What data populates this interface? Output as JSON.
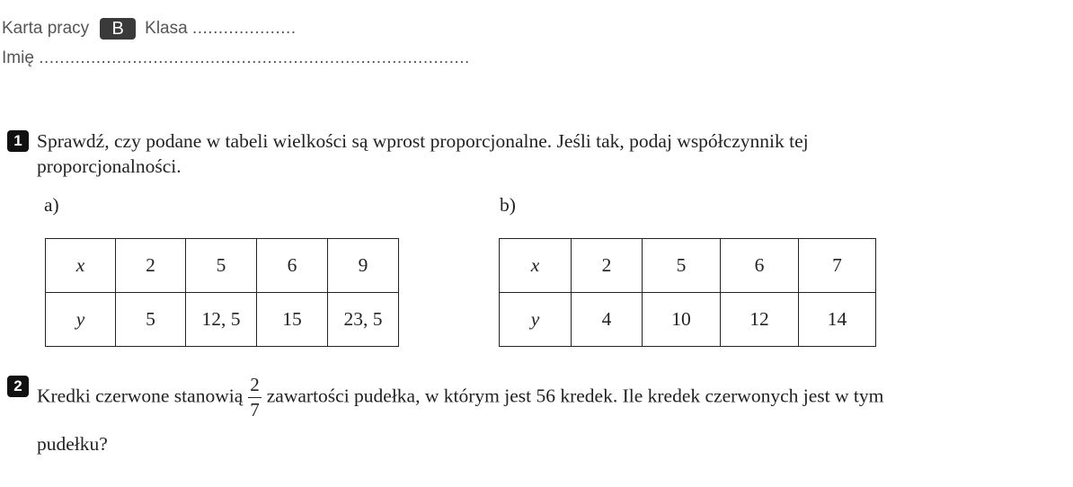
{
  "header": {
    "worksheet_label": "Karta pracy",
    "variant": "B",
    "class_label": "Klasa",
    "class_dots": "....................",
    "name_label": "Imię",
    "name_dots": "..................................................................................."
  },
  "task1": {
    "number": "1",
    "text_line1": "Sprawdź, czy podane w tabeli wielkości są wprost proporcjonalne. Jeśli tak, podaj współczynnik tej",
    "text_line2": "proporcjonalności.",
    "part_a": {
      "label": "a)",
      "x_label": "x",
      "y_label": "y",
      "x_values": [
        "2",
        "5",
        "6",
        "9"
      ],
      "y_values": [
        "5",
        "12, 5",
        "15",
        "23, 5"
      ]
    },
    "part_b": {
      "label": "b)",
      "x_label": "x",
      "y_label": "y",
      "x_values": [
        "2",
        "5",
        "6",
        "7"
      ],
      "y_values": [
        "4",
        "10",
        "12",
        "14"
      ]
    }
  },
  "task2": {
    "number": "2",
    "text_before": "Kredki czerwone stanowią",
    "fraction_numerator": "2",
    "fraction_denominator": "7",
    "text_after": "zawartości pudełka, w którym jest 56 kredek. Ile kredek czerwonych jest w tym",
    "text_line2": "pudełku?"
  }
}
